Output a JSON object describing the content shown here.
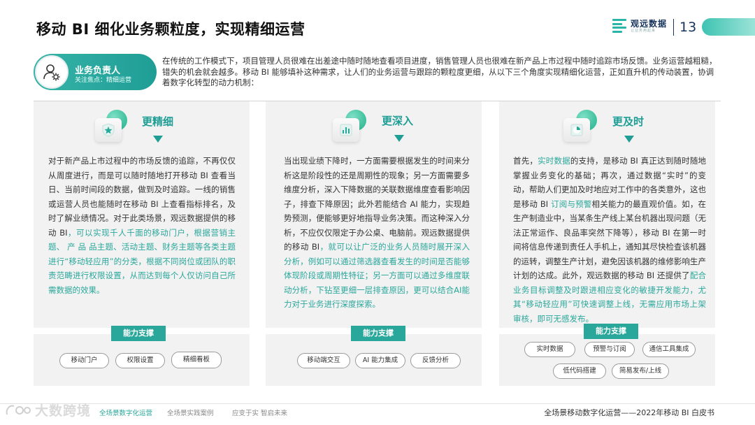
{
  "header": {
    "title": "移动 BI 细化业务颗粒度，实现精细运营",
    "brand_name": "观远数据",
    "brand_sub": "让业务用起来",
    "page_number": "13"
  },
  "role": {
    "title": "业务负责人",
    "focus": "关注焦点：精细运营"
  },
  "intro": "在传统的工作模式下，项目管理人员很难在出差途中随时随地查看项目进度，销售管理人员也很难在新产品上市过程中随时追踪市场反馈。业务运营越粗糙，错失的机会就会越多。移动 BI 能够填补这种需求，让人们的业务运营与跟踪的颗粒度更细，从以下三个角度实现精细化运营，正如直升机的传动装置，协调着数字化转型的动力机制：",
  "cards": [
    {
      "heading": "更精细",
      "body_plain": "对于新产品上市过程中的市场反馈的追踪，不再仅仅从周度进行，而是可以随时随地打开移动 BI 查看当日、当前时间段的数据，做到及时追踪。一线的销售 或运营人员也能随时在移动 BI 上查看指标排名，及时了解业绩情况。对于此类场景，观远数据提供的移动 BI",
      "body_hl": "，可以实现千人千面的移动门户，根据营销主题、 产 品 品主题、活动主题、财务主题等各类主题进行“移动轻应用”的分类，根据不同岗位或团队的职责范畴进行权限设置，从而达到每个人仅访问自己所需数据的效果。",
      "capability_label": "能力支撑",
      "tags": [
        "移动门户",
        "权限设置",
        "精细看板"
      ]
    },
    {
      "heading": "更深入",
      "body_plain": "当出现业绩下降时，一方面需要根据发生的时间来分析这是阶段性的还是周期性的现象；另一方面需要多维度分析，深入下降数据的关联数据维度查看影响因子，排查下降原因；此外若能结合 AI 能力，实现趋势预测，便能够更好地指导业务决策。而这种深入分析，不应仅仅限定于办公桌、电脑前。观远数据提供的移动 BI",
      "body_hl": "，就可以让广泛的业务人员随时展开深入分析，例如可以通过筛选器查看发生的时间是否能够体现阶段或周期性特征；另一方面可以通过多维度联动分析，下钻至更细一层排查原因，更可以结合AI能力对于业务进行深度探索。",
      "capability_label": "能力支撑",
      "tags": [
        "移动端交互",
        "AI 能力集成",
        "反馈分析"
      ]
    },
    {
      "heading": "更及时",
      "body_1": "首先，",
      "body_hl1": "实时数据",
      "body_2": "的支持，是移动 BI 真正达到随时随地掌握业务变化的基础；再次，通过数据“实时”的变动，帮助人们更加及时地应对工作中的各类意外，这也是移动 BI ",
      "body_hl2": "订阅与预警",
      "body_3": "相关能力的最直观价值。如，在生产制造业中，当某条生产线上某台机器出现问题（无法正常运作、良品率突然下降等），移动 BI 在第一时间将信息传递到责任人手机上，通知其尽快检查该机器的运转，调整生产计划，避免因该机器的维修影响生产计划的达成。此外，观远数据的移动 BI 还提供了",
      "body_hl3": "配合业务目标调整及时跟进相应变化的敏捷开发能力，尤其“移动轻应用”可快速调整上线，无需应用市场上架审核，即可无感发布。",
      "capability_label": "能力支撑",
      "tags": [
        "实时数据",
        "预警与订阅",
        "通信工具集成",
        "低代码搭建",
        "简易发布/上线"
      ]
    }
  ],
  "footer": {
    "nav": [
      "全场景数字化运营",
      "全场景实践案例",
      "应变于实  智启未来"
    ],
    "right": "全场景移动数字化运营——2022年移动 BI 白皮书",
    "watermark": "大数跨境"
  },
  "colors": {
    "accent": "#2aa79b",
    "accent_dark": "#1f9e96",
    "navy": "#16335c",
    "card_bg": "#f2f2f2"
  },
  "icons": [
    "brand-logo-icon",
    "user-gear-icon",
    "star-badge-icon",
    "bar-chart-icon",
    "pie-chart-icon",
    "triangle-down-icon"
  ]
}
